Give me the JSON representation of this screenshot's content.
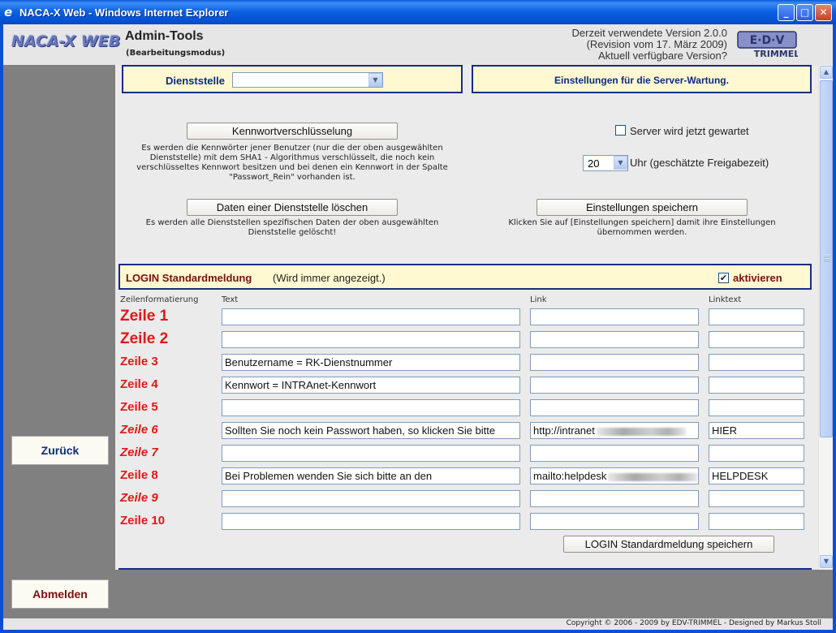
{
  "window": {
    "title": "NACA-X Web - Windows Internet Explorer",
    "minimize": "_",
    "maximize": "□",
    "close": "✕",
    "app_icon": "e"
  },
  "header": {
    "logo_text": "NACA-X WEB",
    "title": "Admin-Tools",
    "subtitle": "(Bearbeitungsmodus)",
    "version_line1": "Derzeit verwendete Version 2.0.0",
    "version_line2": "(Revision vom 17. März 2009)",
    "version_line3": "Aktuell verfügbare Version?",
    "brand_logo": "EDV TRIMMEL",
    "brand_logo_top": "E·D·V",
    "brand_logo_bottom": "TRIMMEL"
  },
  "sidebar": {
    "back_label": "Zurück",
    "logout_label": "Abmelden"
  },
  "dienststelle": {
    "label": "Dienststelle",
    "selected": ""
  },
  "server": {
    "title": "Einstellungen für die Server-Wartung.",
    "maintenance_label": "Server wird jetzt gewartet",
    "maintenance_checked": false,
    "hour_value": "20",
    "hour_label": "Uhr (geschätzte Freigabezeit)",
    "save_label": "Einstellungen speichern",
    "save_desc": "Klicken Sie auf [Einstellungen speichern] damit ihre Einstellungen übernommen werden."
  },
  "tools": {
    "encrypt_label": "Kennwortverschlüsselung",
    "encrypt_desc": "Es werden die Kennwörter jener Benutzer (nur die der oben ausgewählten Dienststelle) mit dem SHA1 - Algorithmus verschlüsselt, die noch kein verschlüsseltes Kennwort besitzen und bei denen ein Kennwort in der Spalte \"Passwort_Rein\" vorhanden ist.",
    "delete_label": "Daten einer Dienststelle löschen",
    "delete_desc": "Es werden alle Dienststellen spezifischen Daten der oben ausgewählten Dienststelle gelöscht!"
  },
  "login": {
    "title": "LOGIN Standardmeldung",
    "note": "(Wird immer angezeigt.)",
    "activate_label": "aktivieren",
    "activate_checked": true,
    "columns": {
      "format": "Zeilenformatierung",
      "text": "Text",
      "link": "Link",
      "linktext": "Linktext"
    },
    "rows": [
      {
        "label": "Zeile 1",
        "text": "",
        "link": "",
        "linktext": ""
      },
      {
        "label": "Zeile 2",
        "text": "",
        "link": "",
        "linktext": ""
      },
      {
        "label": "Zeile 3",
        "text": "Benutzername = RK-Dienstnummer",
        "link": "",
        "linktext": ""
      },
      {
        "label": "Zeile 4",
        "text": "Kennwort = INTRAnet-Kennwort",
        "link": "",
        "linktext": ""
      },
      {
        "label": "Zeile 5",
        "text": "",
        "link": "",
        "linktext": ""
      },
      {
        "label": "Zeile 6",
        "text": "Sollten Sie noch kein Passwort haben, so klicken Sie bitte",
        "link": "http://intranet",
        "linktext": "HIER"
      },
      {
        "label": "Zeile 7",
        "text": "",
        "link": "",
        "linktext": ""
      },
      {
        "label": "Zeile 8",
        "text": "Bei Problemen wenden Sie sich bitte an den",
        "link": "mailto:helpdesk",
        "linktext": "HELPDESK"
      },
      {
        "label": "Zeile 9",
        "text": "",
        "link": "",
        "linktext": ""
      },
      {
        "label": "Zeile 10",
        "text": "",
        "link": "",
        "linktext": ""
      }
    ],
    "save_label": "LOGIN Standardmeldung speichern"
  },
  "footer": {
    "copyright": "Copyright © 2006 - 2009 by EDV-TRIMMEL - Designed by Markus Stoll"
  },
  "icons": {
    "dropdown": "chevron-down-icon",
    "scroll_up": "chevron-up-icon",
    "scroll_down": "chevron-down-icon"
  },
  "colors": {
    "title_bar": "#0a58d8",
    "panel_bg": "#fff8d0",
    "panel_border": "#1a2a88",
    "row_label": "#e01818",
    "login_title": "#7a1010"
  }
}
